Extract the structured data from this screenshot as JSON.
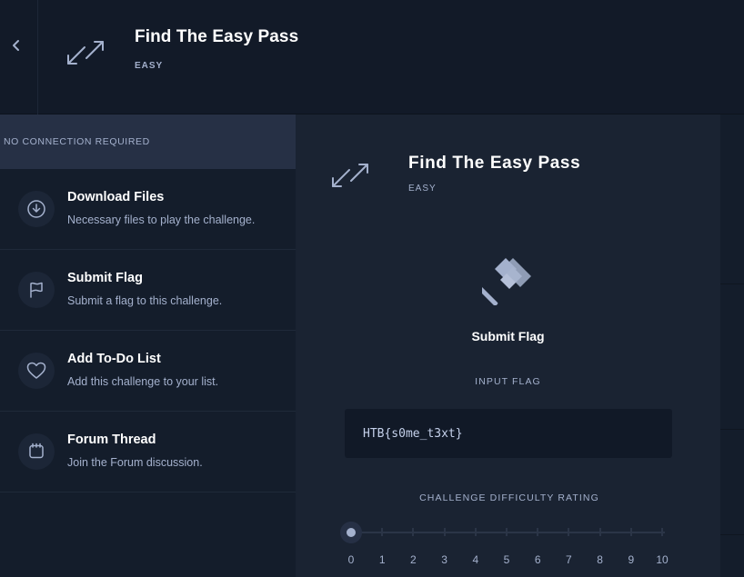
{
  "header": {
    "title": "Find The Easy Pass",
    "difficulty": "EASY",
    "back_icon": "chevron-left-icon",
    "category_icon": "reversing-arrows-icon"
  },
  "sidebar": {
    "connection": "NO CONNECTION REQUIRED",
    "options": [
      {
        "title": "Download Files",
        "desc": "Necessary files to play the challenge.",
        "icon": "download-icon"
      },
      {
        "title": "Submit Flag",
        "desc": "Submit a flag to this challenge.",
        "icon": "flag-icon"
      },
      {
        "title": "Add To-Do List",
        "desc": "Add this challenge to your list.",
        "icon": "heart-icon"
      },
      {
        "title": "Forum Thread",
        "desc": "Join the Forum discussion.",
        "icon": "forum-icon"
      }
    ]
  },
  "panel": {
    "title": "Find The Easy Pass",
    "difficulty": "EASY",
    "submit_label": "Submit Flag",
    "input_label": "INPUT FLAG",
    "flag_value": "HTB{s0me_t3xt}",
    "rating_label": "CHALLENGE DIFFICULTY RATING",
    "rating_value": 0,
    "rating_scale": [
      "0",
      "1",
      "2",
      "3",
      "4",
      "5",
      "6",
      "7",
      "8",
      "9",
      "10"
    ]
  },
  "colors": {
    "background": "#141d2b",
    "panel": "#1a2332",
    "accent_text": "#a4b1cd",
    "highlight_row": "#263045"
  }
}
